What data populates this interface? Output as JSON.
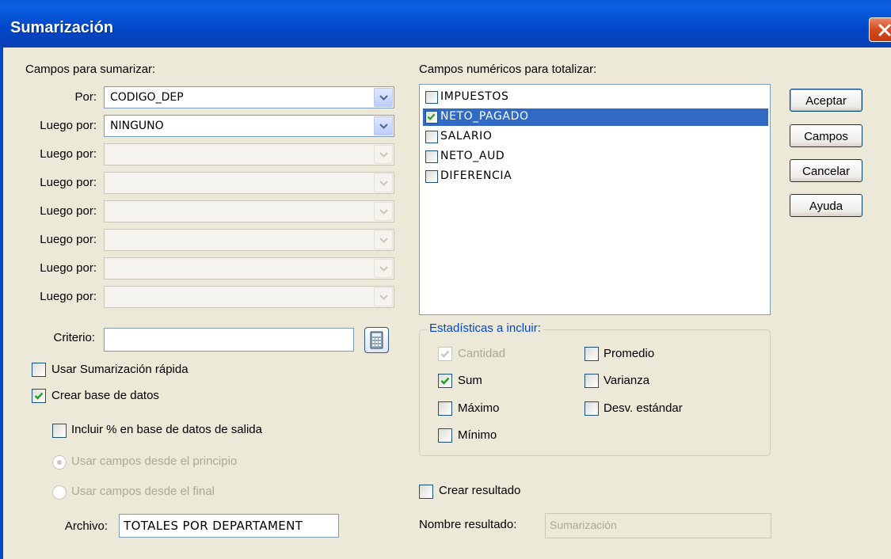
{
  "window": {
    "title": "Sumarización"
  },
  "left": {
    "section_label": "Campos para sumarizar:",
    "rows": [
      {
        "label": "Por:",
        "value": "CODIGO_DEP",
        "enabled": true
      },
      {
        "label": "Luego por:",
        "value": "NINGUNO",
        "enabled": true
      },
      {
        "label": "Luego por:",
        "value": "",
        "enabled": false
      },
      {
        "label": "Luego por:",
        "value": "",
        "enabled": false
      },
      {
        "label": "Luego por:",
        "value": "",
        "enabled": false
      },
      {
        "label": "Luego por:",
        "value": "",
        "enabled": false
      },
      {
        "label": "Luego por:",
        "value": "",
        "enabled": false
      },
      {
        "label": "Luego por:",
        "value": "",
        "enabled": false
      }
    ],
    "criteria_label": "Criterio:",
    "criteria_value": "",
    "quick_label": "Usar Sumarización rápida",
    "quick_checked": false,
    "create_db_label": "Crear base de datos",
    "create_db_checked": true,
    "include_pct_label": "Incluir % en base de datos de salida",
    "include_pct_checked": false,
    "radio_start_label": "Usar campos desde el principio",
    "radio_end_label": "Usar campos desde el final",
    "file_label": "Archivo:",
    "file_value": "TOTALES POR DEPARTAMENT"
  },
  "right": {
    "numeric_label": "Campos numéricos para totalizar:",
    "fields": [
      {
        "name": "IMPUESTOS",
        "checked": false,
        "selected": false
      },
      {
        "name": "NETO_PAGADO",
        "checked": true,
        "selected": true
      },
      {
        "name": "SALARIO",
        "checked": false,
        "selected": false
      },
      {
        "name": "NETO_AUD",
        "checked": false,
        "selected": false
      },
      {
        "name": "DIFERENCIA",
        "checked": false,
        "selected": false
      }
    ],
    "stats_title": "Estadísticas a incluir:",
    "stats": {
      "cantidad": "Cantidad",
      "sum": "Sum",
      "maximo": "Máximo",
      "minimo": "Mínimo",
      "promedio": "Promedio",
      "varianza": "Varianza",
      "desv": "Desv. estándar"
    },
    "create_result_label": "Crear resultado",
    "result_name_label": "Nombre resultado:",
    "result_name_value": "Sumarización"
  },
  "buttons": {
    "accept": "Aceptar",
    "fields": "Campos",
    "cancel": "Cancelar",
    "help": "Ayuda"
  },
  "colors": {
    "title_bar": "#0047c8",
    "dialog_bg": "#ece9d8",
    "selection": "#316ac5",
    "group_title": "#0046d5",
    "close": "#d64a1e"
  }
}
